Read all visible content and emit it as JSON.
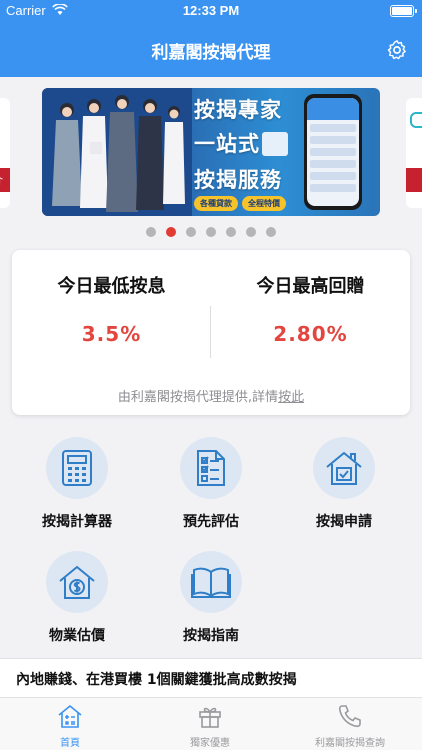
{
  "status_bar": {
    "carrier": "Carrier",
    "time": "12:33 PM"
  },
  "nav": {
    "title": "利嘉閣按揭代理",
    "settings_icon": "gear-icon"
  },
  "banner": {
    "headline_1": "按揭專家",
    "headline_2": "一站式",
    "headline_3": "按揭服務",
    "tag_1": "各種貸款",
    "tag_2": "全程特價"
  },
  "carousel": {
    "page_count": 7,
    "active_index": 1
  },
  "rates": {
    "lowest_label": "今日最低按息",
    "lowest_value": "3.5%",
    "highest_label": "今日最高回贈",
    "highest_value": "2.80%",
    "source_text": "由利嘉閣按揭代理提供,詳情",
    "source_link": "按此"
  },
  "menu": {
    "items": [
      {
        "label": "按揭計算器",
        "icon": "calculator-icon"
      },
      {
        "label": "預先評估",
        "icon": "checklist-document-icon"
      },
      {
        "label": "按揭申請",
        "icon": "house-check-icon"
      },
      {
        "label": "物業估價",
        "icon": "house-dollar-icon"
      },
      {
        "label": "按揭指南",
        "icon": "open-book-icon"
      }
    ]
  },
  "news": {
    "headline": "內地賺錢、在港買樓 1個關鍵獲批高成數按揭"
  },
  "tabs": [
    {
      "label": "首頁",
      "icon": "home-calculator-icon",
      "active": true
    },
    {
      "label": "獨家優惠",
      "icon": "gift-icon",
      "active": false
    },
    {
      "label": "利嘉閣按揭查詢",
      "icon": "phone-icon",
      "active": false
    }
  ],
  "colors": {
    "primary": "#3a93f1",
    "rate_red": "#e2463f",
    "dot_active": "#e23b34",
    "icon_bg": "#dde7f3"
  }
}
